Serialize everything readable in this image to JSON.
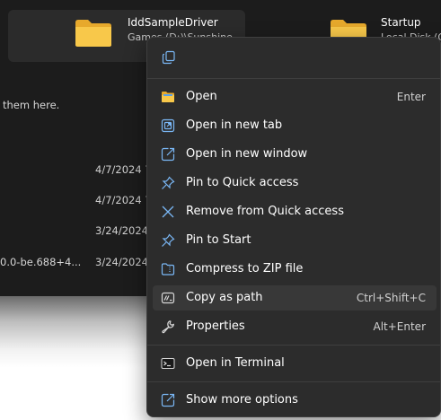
{
  "explorer": {
    "tiles": [
      {
        "title": "IddSampleDriver",
        "subtitle": "Games (D:)\\Sunshine"
      },
      {
        "title": "Startup",
        "subtitle": "Local Disk (C"
      }
    ],
    "hint_text": "them here.",
    "rows": [
      {
        "name": "",
        "date": "4/7/2024 7"
      },
      {
        "name": "",
        "date": "4/7/2024 7"
      },
      {
        "name": "",
        "date": "3/24/2024"
      },
      {
        "name": "0.0-be.688+4...",
        "date": "3/24/2024"
      }
    ]
  },
  "context_menu": {
    "top_icon": "copy-icon",
    "items": [
      {
        "label": "Open",
        "shortcut": "Enter",
        "icon": "folder-open-icon"
      },
      {
        "label": "Open in new tab",
        "shortcut": "",
        "icon": "new-tab-icon"
      },
      {
        "label": "Open in new window",
        "shortcut": "",
        "icon": "new-window-icon"
      },
      {
        "label": "Pin to Quick access",
        "shortcut": "",
        "icon": "pin-icon"
      },
      {
        "label": "Remove from Quick access",
        "shortcut": "",
        "icon": "close-icon"
      },
      {
        "label": "Pin to Start",
        "shortcut": "",
        "icon": "pin-icon"
      },
      {
        "label": "Compress to ZIP file",
        "shortcut": "",
        "icon": "zip-folder-icon"
      },
      {
        "label": "Copy as path",
        "shortcut": "Ctrl+Shift+C",
        "icon": "copy-path-icon",
        "highlighted": true
      },
      {
        "label": "Properties",
        "shortcut": "Alt+Enter",
        "icon": "wrench-icon"
      },
      {
        "label": "Open in Terminal",
        "shortcut": "",
        "icon": "terminal-icon"
      },
      {
        "label": "Show more options",
        "shortcut": "",
        "icon": "show-more-icon"
      }
    ]
  },
  "colors": {
    "menu_background": "#2c2c2c",
    "menu_highlight": "#383838",
    "icon_blue": "#7ab7f5",
    "folder_yellow": "#f5c542"
  }
}
